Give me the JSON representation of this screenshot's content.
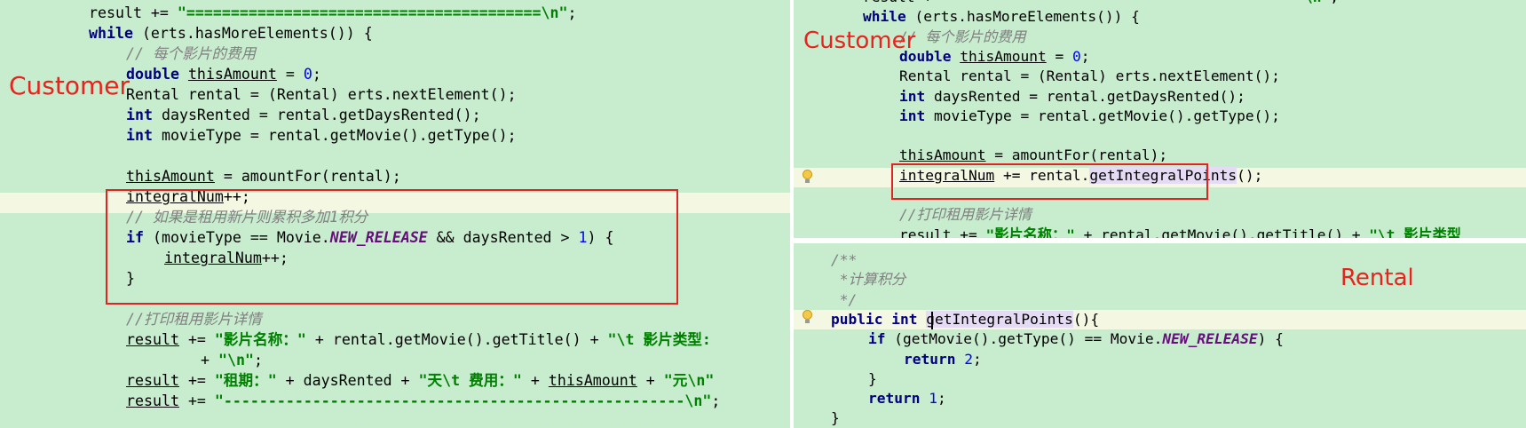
{
  "left": {
    "label": "Customer",
    "lines": [
      [
        [
          "",
          "result += "
        ],
        [
          "str",
          "\"========================================\\n\""
        ],
        [
          "",
          ";"
        ]
      ],
      [
        [
          "kw",
          "while"
        ],
        [
          "",
          " (erts.hasMoreElements()) {"
        ]
      ],
      [
        [
          "cmt",
          "// 每个影片的费用"
        ]
      ],
      [
        [
          "kw",
          "double "
        ],
        [
          "u",
          "thisAmount"
        ],
        [
          "",
          " = "
        ],
        [
          "num",
          "0"
        ],
        [
          "",
          ";"
        ]
      ],
      [
        [
          "",
          "Rental rental = (Rental) erts.nextElement();"
        ]
      ],
      [
        [
          "kw",
          "int"
        ],
        [
          "",
          " daysRented = rental.getDaysRented();"
        ]
      ],
      [
        [
          "kw",
          "int"
        ],
        [
          "",
          " movieType = rental.getMovie().getType();"
        ]
      ],
      [],
      [
        [
          "u",
          "thisAmount"
        ],
        [
          "",
          " = amountFor(rental);"
        ]
      ],
      [
        [
          "u",
          "integralNum"
        ],
        [
          "",
          "++;"
        ]
      ],
      [
        [
          "cmt",
          "// 如果是租用新片则累积多加1积分"
        ]
      ],
      [
        [
          "kw",
          "if"
        ],
        [
          "",
          " (movieType == Movie."
        ],
        [
          "fld",
          "NEW_RELEASE"
        ],
        [
          "",
          " && daysRented > "
        ],
        [
          "num",
          "1"
        ],
        [
          "",
          ") {"
        ]
      ],
      [
        [
          "u",
          "integralNum"
        ],
        [
          "",
          "++;"
        ]
      ],
      [
        [
          "",
          "}"
        ]
      ],
      [],
      [
        [
          "cmt",
          "//打印租用影片详情"
        ]
      ],
      [
        [
          "u",
          "result"
        ],
        [
          "",
          " += "
        ],
        [
          "str",
          "\"影片名称：\""
        ],
        [
          "",
          " + rental.getMovie().getTitle() + "
        ],
        [
          "str",
          "\"\\t 影片类型:"
        ]
      ],
      [
        [
          "",
          "+ "
        ],
        [
          "str",
          "\"\\n\""
        ],
        [
          "",
          ";"
        ]
      ],
      [
        [
          "u",
          "result"
        ],
        [
          "",
          " += "
        ],
        [
          "str",
          "\"租期：\""
        ],
        [
          "",
          " + daysRented + "
        ],
        [
          "str",
          "\"天\\t 费用：\""
        ],
        [
          "",
          " + "
        ],
        [
          "u",
          "thisAmount"
        ],
        [
          "",
          " + "
        ],
        [
          "str",
          "\"元\\n\""
        ]
      ],
      [
        [
          "u",
          "result"
        ],
        [
          "",
          " += "
        ],
        [
          "str",
          "\"----------------------------------------------------\\n\""
        ],
        [
          "",
          ";"
        ]
      ]
    ]
  },
  "right_top": {
    "label": "Customer",
    "lines": [
      [
        [
          "",
          "result += "
        ],
        [
          "str",
          "\"========================================\\n\""
        ],
        [
          "",
          ";"
        ]
      ],
      [
        [
          "kw",
          "while"
        ],
        [
          "",
          " (erts.hasMoreElements()) {"
        ]
      ],
      [
        [
          "cmt",
          "// 每个影片的费用"
        ]
      ],
      [
        [
          "kw",
          "double "
        ],
        [
          "u",
          "thisAmount"
        ],
        [
          "",
          " = "
        ],
        [
          "num",
          "0"
        ],
        [
          "",
          ";"
        ]
      ],
      [
        [
          "",
          "Rental rental = (Rental) erts.nextElement();"
        ]
      ],
      [
        [
          "kw",
          "int"
        ],
        [
          "",
          " daysRented = rental.getDaysRented();"
        ]
      ],
      [
        [
          "kw",
          "int"
        ],
        [
          "",
          " movieType = rental.getMovie().getType();"
        ]
      ],
      [],
      [
        [
          "u",
          "thisAmount"
        ],
        [
          "",
          " = amountFor(rental);"
        ]
      ],
      [
        [
          "u",
          "integralNum"
        ],
        [
          "",
          " += rental."
        ],
        [
          "sel",
          "getIntegralPoints"
        ],
        [
          "",
          "();"
        ]
      ],
      [],
      [
        [
          "cmt",
          "//打印租用影片详情"
        ]
      ],
      [
        [
          "u",
          "result"
        ],
        [
          "",
          " += "
        ],
        [
          "str",
          "\"影片名称：\""
        ],
        [
          "",
          " + rental.getMovie().getTitle() + "
        ],
        [
          "str",
          "\"\\t 影片类型"
        ]
      ]
    ]
  },
  "right_bottom": {
    "label": "Rental",
    "lines": [
      [
        [
          "cmt",
          "/**"
        ]
      ],
      [
        [
          "cmt",
          " *计算积分"
        ]
      ],
      [
        [
          "cmt",
          " */"
        ]
      ],
      [
        [
          "kw",
          "public int "
        ],
        [
          "sel",
          "getIntegralPoints"
        ],
        [
          "",
          "(){"
        ]
      ],
      [
        [
          "kw",
          "if"
        ],
        [
          "",
          " (getMovie().getType() == Movie."
        ],
        [
          "fld",
          "NEW_RELEASE"
        ],
        [
          "",
          ") {"
        ]
      ],
      [
        [
          "kw",
          "return "
        ],
        [
          "num",
          "2"
        ],
        [
          "",
          ";"
        ]
      ],
      [
        [
          "",
          "}"
        ]
      ],
      [
        [
          "kw",
          "return "
        ],
        [
          "num",
          "1"
        ],
        [
          "",
          ";"
        ]
      ],
      [
        [
          "",
          "}"
        ]
      ]
    ]
  }
}
